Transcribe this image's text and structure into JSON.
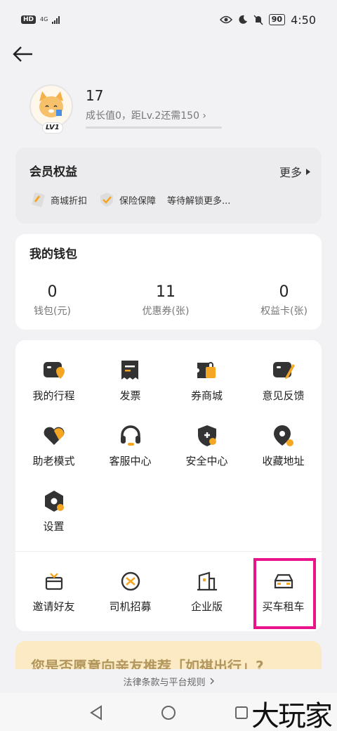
{
  "status_bar": {
    "hd": "HD",
    "network": "4G",
    "battery": "90",
    "time": "4:50"
  },
  "profile": {
    "name": "17",
    "level_badge": "LV1",
    "growth_text": "成长值0，距Lv.2还需150 ›",
    "growth_progress": 0
  },
  "benefits": {
    "title": "会员权益",
    "more": "更多",
    "items": [
      "商城折扣",
      "保险保障",
      "等待解锁更多..."
    ]
  },
  "wallet": {
    "title": "我的钱包",
    "items": [
      {
        "value": "0",
        "label": "钱包(元)"
      },
      {
        "value": "11",
        "label": "优惠券(张)"
      },
      {
        "value": "0",
        "label": "权益卡(张)"
      }
    ]
  },
  "services": {
    "row1": [
      "我的行程",
      "发票",
      "券商城",
      "意见反馈"
    ],
    "row2": [
      "助老模式",
      "客服中心",
      "安全中心",
      "收藏地址"
    ],
    "row3": [
      "设置"
    ],
    "row4": [
      "邀请好友",
      "司机招募",
      "企业版",
      "买车租车"
    ]
  },
  "promo": {
    "text": "您是否愿意向亲友推荐「如祺出行」?"
  },
  "legal": {
    "text": "法律条款与平台规则"
  },
  "watermark": "大玩家",
  "colors": {
    "accent": "#f5a623",
    "icon_dark": "#333333",
    "highlight": "#e9148a"
  }
}
